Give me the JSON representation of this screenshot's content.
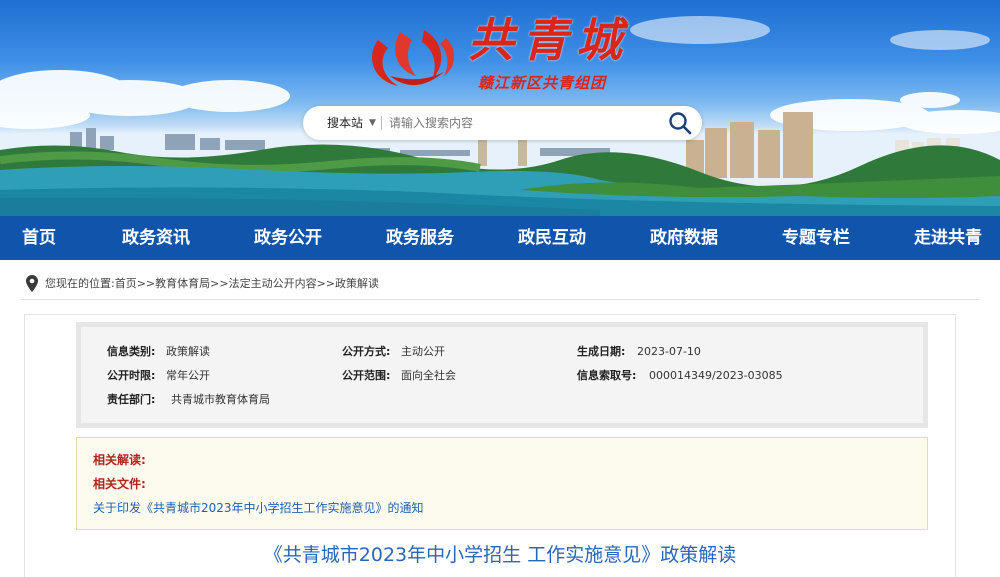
{
  "site": {
    "logo_title": "共青城",
    "logo_subtitle": "赣江新区共青组团"
  },
  "search": {
    "scope": "搜本站",
    "placeholder": "请输入搜索内容"
  },
  "nav": {
    "items": [
      {
        "label": "首页"
      },
      {
        "label": "政务资讯"
      },
      {
        "label": "政务公开"
      },
      {
        "label": "政务服务"
      },
      {
        "label": "政民互动"
      },
      {
        "label": "政府数据"
      },
      {
        "label": "专题专栏"
      },
      {
        "label": "走进共青"
      }
    ]
  },
  "breadcrumb": {
    "text": "您现在的位置:首页>>教育体育局>>法定主动公开内容>>政策解读"
  },
  "meta": {
    "category_label": "信息类别:",
    "category_value": "政策解读",
    "method_label": "公开方式:",
    "method_value": "主动公开",
    "date_label": "生成日期:",
    "date_value": "2023-07-10",
    "period_label": "公开时限:",
    "period_value": "常年公开",
    "scope_label": "公开范围:",
    "scope_value": "面向全社会",
    "index_label": "信息索取号:",
    "index_value": "000014349/2023-03085",
    "dept_label": "责任部门:",
    "dept_value": "共青城市教育体育局"
  },
  "related": {
    "interpret_label": "相关解读:",
    "docs_label": "相关文件:",
    "doc_link": "关于印发《共青城市2023年中小学招生工作实施意见》的通知"
  },
  "article": {
    "title": "《共青城市2023年中小学招生 工作实施意见》政策解读"
  },
  "colors": {
    "nav_bg": "#1054ab",
    "logo_red": "#d8261c",
    "link_blue": "#1f5fb4",
    "title_blue": "#2a66b8"
  }
}
